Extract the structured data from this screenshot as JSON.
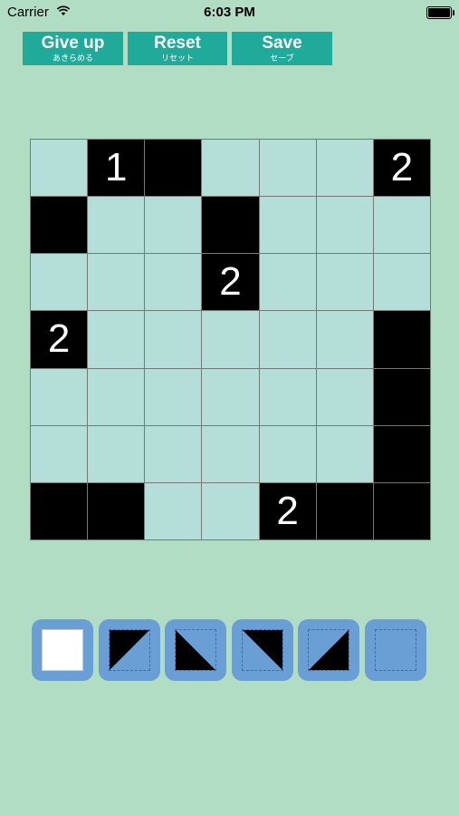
{
  "status_bar": {
    "carrier": "Carrier",
    "time": "6:03 PM"
  },
  "toolbar": {
    "give_up": {
      "label": "Give up",
      "sub": "あきらめる"
    },
    "reset": {
      "label": "Reset",
      "sub": "リセット"
    },
    "save": {
      "label": "Save",
      "sub": "セーブ"
    }
  },
  "board": {
    "rows": [
      [
        {
          "black": false,
          "n": ""
        },
        {
          "black": true,
          "n": "1"
        },
        {
          "black": true,
          "n": ""
        },
        {
          "black": false,
          "n": ""
        },
        {
          "black": false,
          "n": ""
        },
        {
          "black": false,
          "n": ""
        },
        {
          "black": true,
          "n": "2"
        }
      ],
      [
        {
          "black": true,
          "n": ""
        },
        {
          "black": false,
          "n": ""
        },
        {
          "black": false,
          "n": ""
        },
        {
          "black": true,
          "n": ""
        },
        {
          "black": false,
          "n": ""
        },
        {
          "black": false,
          "n": ""
        },
        {
          "black": false,
          "n": ""
        }
      ],
      [
        {
          "black": false,
          "n": ""
        },
        {
          "black": false,
          "n": ""
        },
        {
          "black": false,
          "n": ""
        },
        {
          "black": true,
          "n": "2"
        },
        {
          "black": false,
          "n": ""
        },
        {
          "black": false,
          "n": ""
        },
        {
          "black": false,
          "n": ""
        }
      ],
      [
        {
          "black": true,
          "n": "2"
        },
        {
          "black": false,
          "n": ""
        },
        {
          "black": false,
          "n": ""
        },
        {
          "black": false,
          "n": ""
        },
        {
          "black": false,
          "n": ""
        },
        {
          "black": false,
          "n": ""
        },
        {
          "black": true,
          "n": ""
        }
      ],
      [
        {
          "black": false,
          "n": ""
        },
        {
          "black": false,
          "n": ""
        },
        {
          "black": false,
          "n": ""
        },
        {
          "black": false,
          "n": ""
        },
        {
          "black": false,
          "n": ""
        },
        {
          "black": false,
          "n": ""
        },
        {
          "black": true,
          "n": ""
        }
      ],
      [
        {
          "black": false,
          "n": ""
        },
        {
          "black": false,
          "n": ""
        },
        {
          "black": false,
          "n": ""
        },
        {
          "black": false,
          "n": ""
        },
        {
          "black": false,
          "n": ""
        },
        {
          "black": false,
          "n": ""
        },
        {
          "black": true,
          "n": ""
        }
      ],
      [
        {
          "black": true,
          "n": ""
        },
        {
          "black": true,
          "n": ""
        },
        {
          "black": false,
          "n": ""
        },
        {
          "black": false,
          "n": ""
        },
        {
          "black": true,
          "n": "2"
        },
        {
          "black": true,
          "n": ""
        },
        {
          "black": true,
          "n": ""
        }
      ]
    ]
  },
  "palette": {
    "tiles": [
      {
        "name": "tile-white-selected",
        "shape": "white",
        "selected": true
      },
      {
        "name": "tile-triangle-bottom-left",
        "shape": "triangle-bottom-left",
        "selected": false
      },
      {
        "name": "tile-triangle-top-right-diag",
        "shape": "triangle-upper-left-down",
        "selected": false
      },
      {
        "name": "tile-triangle-top-right",
        "shape": "triangle-top-right",
        "selected": false
      },
      {
        "name": "tile-triangle-bottom-right",
        "shape": "triangle-bottom-right",
        "selected": false
      },
      {
        "name": "tile-empty",
        "shape": "empty",
        "selected": false
      }
    ]
  },
  "colors": {
    "background": "#b1ddc5",
    "button": "#1faa9a",
    "cell": "#b3dfd8",
    "tile": "#6a9fd6"
  }
}
